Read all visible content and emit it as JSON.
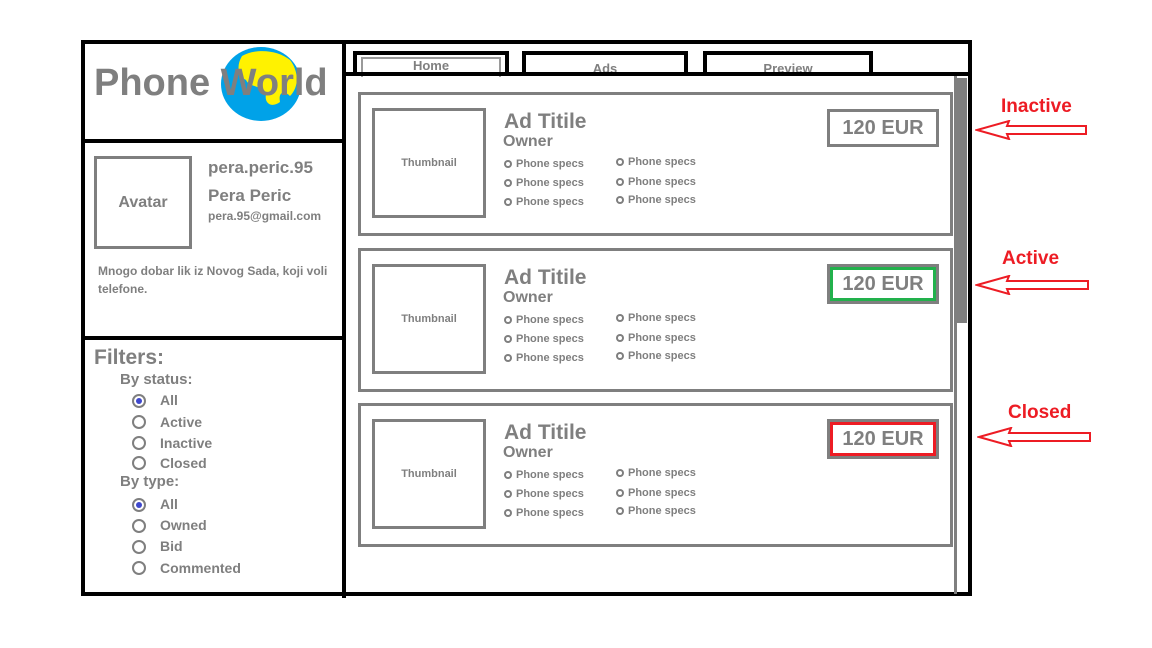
{
  "app": {
    "title": "Phone World"
  },
  "tabs": [
    {
      "label": "Home"
    },
    {
      "label": "Ads"
    },
    {
      "label": "Preview"
    }
  ],
  "profile": {
    "avatar_label": "Avatar",
    "username": "pera.peric.95",
    "full_name": "Pera Peric",
    "email": "pera.95@gmail.com",
    "bio": "Mnogo dobar lik iz Novog Sada, koji voli telefone."
  },
  "filters": {
    "title": "Filters:",
    "status": {
      "label": "By status:",
      "options": [
        "All",
        "Active",
        "Inactive",
        "Closed"
      ],
      "selected": "All"
    },
    "type": {
      "label": "By type:",
      "options": [
        "All",
        "Owned",
        "Bid",
        "Commented"
      ],
      "selected": "All"
    }
  },
  "ads": [
    {
      "thumbnail": "Thumbnail",
      "title": "Ad Titile",
      "owner": "Owner",
      "specs": [
        "Phone specs",
        "Phone specs",
        "Phone specs",
        "Phone specs",
        "Phone specs",
        "Phone specs"
      ],
      "price": "120 EUR",
      "status": "inactive"
    },
    {
      "thumbnail": "Thumbnail",
      "title": "Ad Titile",
      "owner": "Owner",
      "specs": [
        "Phone specs",
        "Phone specs",
        "Phone specs",
        "Phone specs",
        "Phone specs",
        "Phone specs"
      ],
      "price": "120 EUR",
      "status": "active"
    },
    {
      "thumbnail": "Thumbnail",
      "title": "Ad Titile",
      "owner": "Owner",
      "specs": [
        "Phone specs",
        "Phone specs",
        "Phone specs",
        "Phone specs",
        "Phone specs",
        "Phone specs"
      ],
      "price": "120 EUR",
      "status": "closed"
    }
  ],
  "annotations": [
    "Inactive",
    "Active",
    "Closed"
  ],
  "colors": {
    "text_gray": "#7f7f7f",
    "active_border": "#22b14c",
    "closed_border": "#ed1c24",
    "annotation": "#ed1c24",
    "radio_selected": "#3f48cc",
    "globe_blue": "#00a2e8",
    "globe_yellow": "#fff200"
  },
  "icons": [
    "globe-logo-icon",
    "arrow-left-icon"
  ]
}
